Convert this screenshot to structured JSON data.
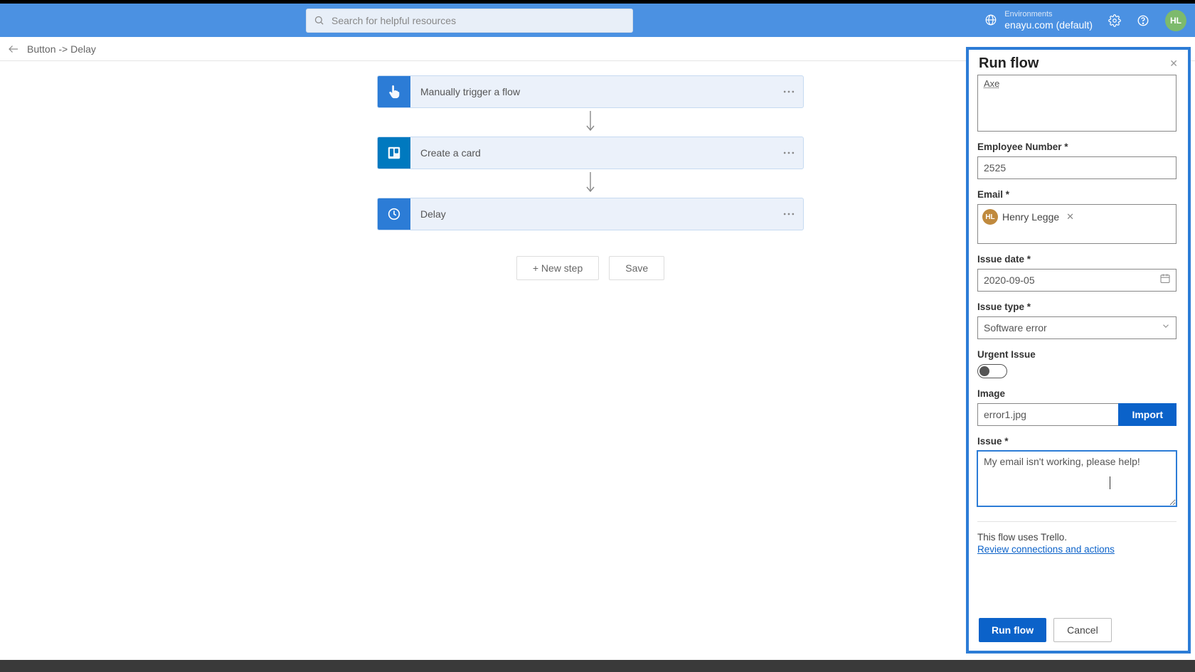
{
  "header": {
    "search_placeholder": "Search for helpful resources",
    "env_label": "Environments",
    "env_name": "enayu.com (default)",
    "avatar_initials": "HL"
  },
  "breadcrumb": "Button -> Delay",
  "flow": {
    "steps": [
      {
        "label": "Manually trigger a flow",
        "icon": "touch"
      },
      {
        "label": "Create a card",
        "icon": "trello"
      },
      {
        "label": "Delay",
        "icon": "clock"
      }
    ],
    "new_step": "+ New step",
    "save": "Save"
  },
  "panel": {
    "title": "Run flow",
    "truncated_field_value": "Axe",
    "fields": {
      "employee_number": {
        "label": "Employee Number *",
        "value": "2525"
      },
      "email": {
        "label": "Email *",
        "chip_name": "Henry Legge",
        "chip_initials": "HL"
      },
      "issue_date": {
        "label": "Issue date *",
        "value": "2020-09-05"
      },
      "issue_type": {
        "label": "Issue type *",
        "value": "Software error"
      },
      "urgent": {
        "label": "Urgent Issue",
        "on": false
      },
      "image": {
        "label": "Image",
        "value": "error1.jpg",
        "import": "Import"
      },
      "issue": {
        "label": "Issue *",
        "value": "My email isn't working, please help!"
      }
    },
    "uses_text": "This flow uses Trello.",
    "review_link": "Review connections and actions",
    "run_btn": "Run flow",
    "cancel_btn": "Cancel"
  }
}
